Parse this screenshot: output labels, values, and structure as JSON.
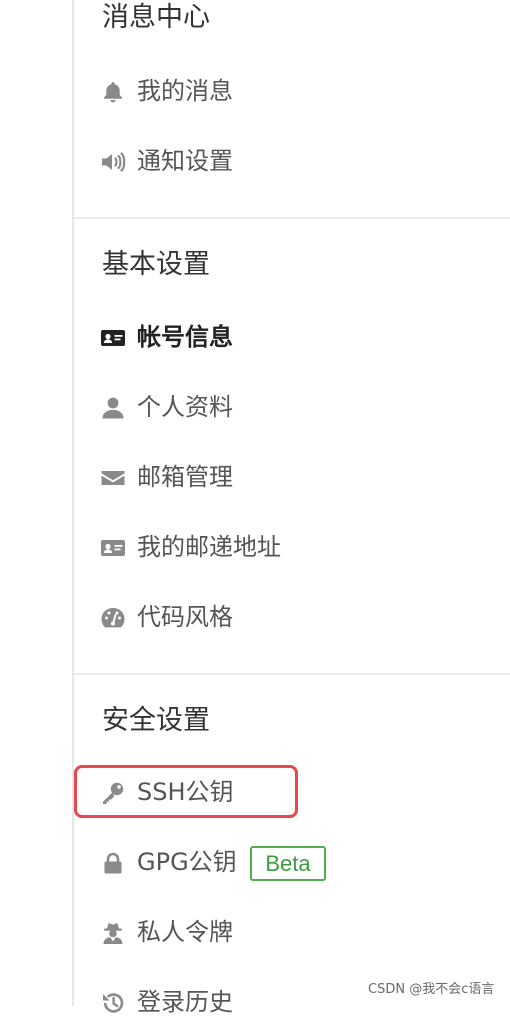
{
  "sections": {
    "messages": {
      "title": "消息中心",
      "items": [
        {
          "label": "我的消息",
          "icon": "bell-icon"
        },
        {
          "label": "通知设置",
          "icon": "speaker-icon"
        }
      ]
    },
    "basic": {
      "title": "基本设置",
      "items": [
        {
          "label": "帐号信息",
          "icon": "id-card-icon",
          "active": true
        },
        {
          "label": "个人资料",
          "icon": "user-icon"
        },
        {
          "label": "邮箱管理",
          "icon": "envelope-icon"
        },
        {
          "label": "我的邮递地址",
          "icon": "address-card-icon"
        },
        {
          "label": "代码风格",
          "icon": "palette-icon"
        }
      ]
    },
    "security": {
      "title": "安全设置",
      "items": [
        {
          "label": "SSH公钥",
          "icon": "key-icon",
          "highlighted": true
        },
        {
          "label": "GPG公钥",
          "icon": "lock-icon",
          "badge": "Beta"
        },
        {
          "label": "私人令牌",
          "icon": "user-secret-icon"
        },
        {
          "label": "登录历史",
          "icon": "history-icon"
        }
      ]
    }
  },
  "watermark": "CSDN @我不会c语言",
  "colors": {
    "highlight_border": "#e5484d",
    "badge_green": "#4caf50",
    "icon_gray": "#8a8a8a",
    "active_icon": "#222222"
  }
}
